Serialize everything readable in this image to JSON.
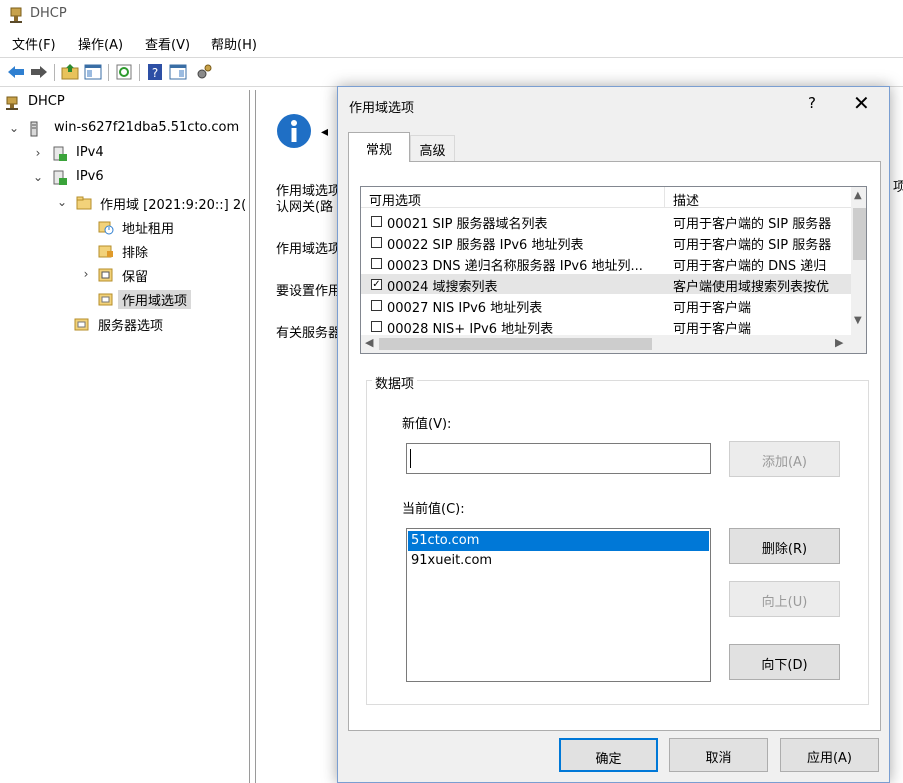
{
  "window": {
    "title": "DHCP"
  },
  "menu": [
    "文件(F)",
    "操作(A)",
    "查看(V)",
    "帮助(H)"
  ],
  "tree": {
    "root": "DHCP",
    "server": "win-s627f21dba5.51cto.com",
    "ipv4": "IPv4",
    "ipv6": "IPv6",
    "scope": "作用域 [2021:9:20::] 2(",
    "leases": "地址租用",
    "exclusions": "排除",
    "reservations": "保留",
    "scope_options": "作用域选项",
    "server_options": "服务器选项"
  },
  "background_pane": {
    "lines": [
      "作用域选项",
      "认网关(路",
      "作用域选项",
      "要设置作用",
      "有关服务器"
    ],
    "right_edge_char": "项"
  },
  "dialog": {
    "title": "作用域选项",
    "help": "?",
    "close": "✕",
    "tabs": [
      "常规",
      "高级"
    ],
    "list": {
      "col_available": "可用选项",
      "col_description": "描述",
      "rows": [
        {
          "checked": false,
          "name": "00021 SIP 服务器域名列表",
          "desc": "可用于客户端的 SIP 服务器"
        },
        {
          "checked": false,
          "name": "00022 SIP 服务器 IPv6 地址列表",
          "desc": "可用于客户端的 SIP 服务器"
        },
        {
          "checked": false,
          "name": "00023 DNS 递归名称服务器 IPv6 地址列...",
          "desc": "可用于客户端的 DNS 递归"
        },
        {
          "checked": true,
          "name": "00024 域搜索列表",
          "desc": "客户端使用域搜索列表按优"
        },
        {
          "checked": false,
          "name": "00027 NIS IPv6 地址列表",
          "desc": "可用于客户端"
        },
        {
          "checked": false,
          "name": "00028 NIS+ IPv6 地址列表",
          "desc": "可用于客户端"
        }
      ]
    },
    "data_group": "数据项",
    "new_value_label": "新值(V):",
    "new_value": "",
    "add_button": "添加(A)",
    "current_value_label": "当前值(C):",
    "current_values": [
      "51cto.com",
      "91xueit.com"
    ],
    "delete_button": "删除(R)",
    "up_button": "向上(U)",
    "down_button": "向下(D)",
    "ok_button": "确定",
    "cancel_button": "取消",
    "apply_button": "应用(A)"
  },
  "colors": {
    "selection": "#0078d7",
    "default_button_border": "#0078d7"
  }
}
